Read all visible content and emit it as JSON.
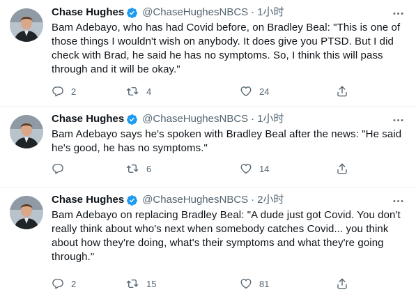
{
  "tweets": [
    {
      "name": "Chase Hughes",
      "handle": "@ChaseHughesNBCS",
      "dot": "·",
      "time": "1小时",
      "text": "Bam Adebayo, who has had Covid before, on Bradley Beal: \"This is one of those things I wouldn't wish on anybody. It does give you PTSD. But I did check with Brad, he said he has no symptoms. So, I think this will pass through and it will be okay.\"",
      "replies": "2",
      "retweets": "4",
      "likes": "24"
    },
    {
      "name": "Chase Hughes",
      "handle": "@ChaseHughesNBCS",
      "dot": "·",
      "time": "1小时",
      "text": "Bam Adebayo says he's spoken with Bradley Beal after the news: \"He said he's good, he has no symptoms.\"",
      "replies": "",
      "retweets": "6",
      "likes": "14"
    },
    {
      "name": "Chase Hughes",
      "handle": "@ChaseHughesNBCS",
      "dot": "·",
      "time": "2小时",
      "text": "Bam Adebayo on replacing Bradley Beal: \"A dude just got Covid. You don't really think about who's next when somebody catches Covid... you think about how they're doing, what's their symptoms and what they're going through.\"",
      "replies": "2",
      "retweets": "15",
      "likes": "81"
    }
  ],
  "icons": {
    "verified": "verified-badge-icon",
    "more": "more-icon",
    "reply": "reply-icon",
    "retweet": "retweet-icon",
    "like": "heart-icon",
    "share": "share-icon"
  },
  "colors": {
    "verified": "#1d9bf0",
    "text": "#0f1419",
    "muted": "#536471",
    "divider": "#eff3f4"
  }
}
